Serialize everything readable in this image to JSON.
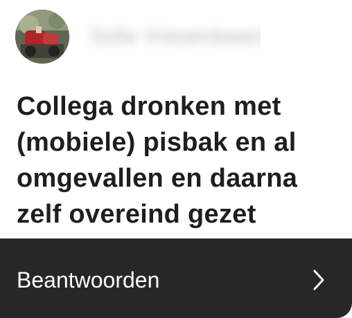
{
  "card": {
    "username": "Sofie Vriesenbaard",
    "question": "Collega dronken met (mobiele) pisbak en al omgevallen en daarna zelf overeind gezet",
    "reply_label": "Beantwoorden"
  },
  "icons": {
    "avatar": "profile-photo",
    "reply_chevron": "chevron-right-icon"
  },
  "colors": {
    "background": "#ffffff",
    "footer": "#272727",
    "question_text": "#1e1e1e",
    "footer_text": "#ffffff"
  }
}
